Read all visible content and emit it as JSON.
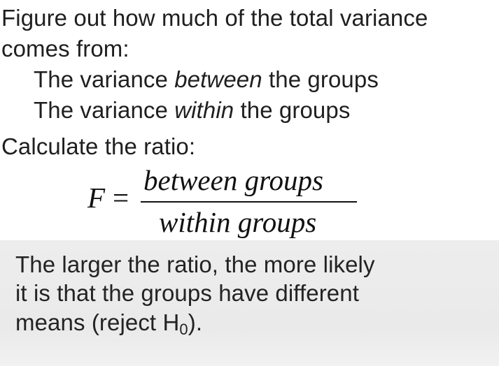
{
  "slide": {
    "intro_line1": "Figure out how much of the total variance",
    "intro_line2": "comes from:",
    "bullet1": {
      "prefix": "The variance ",
      "emph": "between",
      "suffix": " the groups"
    },
    "bullet2": {
      "prefix": "The variance ",
      "emph": "within",
      "suffix": " the groups"
    },
    "calc_label": "Calculate the ratio:",
    "formula": {
      "lhs": "F",
      "eq": "=",
      "numerator": "between groups",
      "denominator": "within groups"
    },
    "conclusion_line1": "The larger the ratio, the more likely",
    "conclusion_line2": "it is that the groups have different",
    "conclusion_line3_prefix": "means (reject H",
    "conclusion_sub": "0",
    "conclusion_suffix": ")."
  }
}
